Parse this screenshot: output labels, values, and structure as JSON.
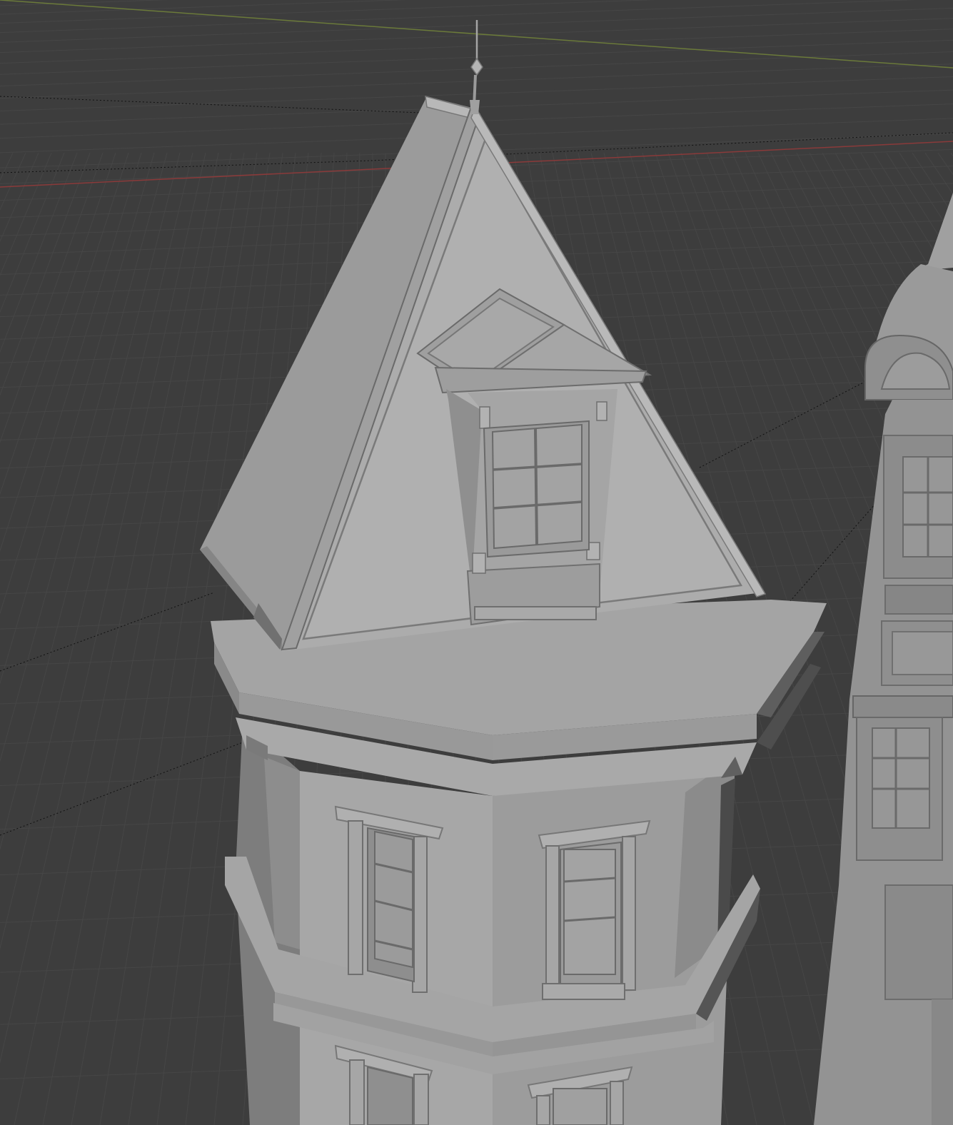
{
  "viewport": {
    "background_color": "#3d3d3d",
    "grid_minor_color": "#464646",
    "grid_major_color": "#4b4b4b",
    "x_axis_color": "#8a3a3a",
    "y_axis_color": "#6b7a3a",
    "mode": "solid-shading"
  },
  "model": {
    "base_color": "#9a9a9a",
    "highlight_color": "#b3b3b3",
    "shadow_color": "#7a7a7a",
    "dark_color": "#5c5c5c",
    "window_glass_color": "#8e8e8e"
  },
  "objects": [
    {
      "name": "spire-finial",
      "icon": "spire"
    },
    {
      "name": "pyramid-roof",
      "icon": "roof"
    },
    {
      "name": "dormer-window",
      "icon": "window"
    },
    {
      "name": "octagonal-tower",
      "icon": "tower"
    },
    {
      "name": "neighbor-tower",
      "icon": "tower"
    }
  ]
}
